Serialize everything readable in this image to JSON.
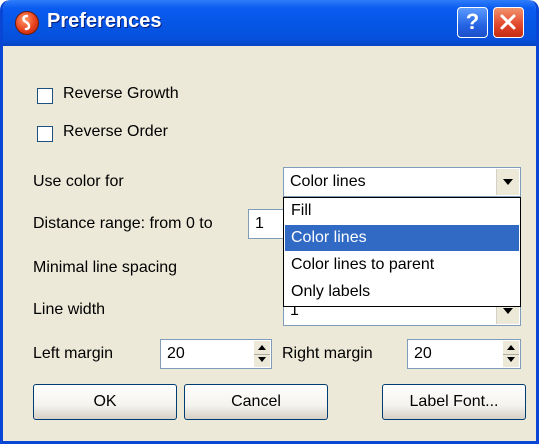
{
  "window": {
    "title": "Preferences",
    "help_label": "?"
  },
  "options": {
    "reverse_growth_label": "Reverse Growth",
    "reverse_order_label": "Reverse Order",
    "reverse_growth_checked": false,
    "reverse_order_checked": false
  },
  "use_color": {
    "label": "Use color for",
    "selected": "Color lines",
    "options": [
      "Fill",
      "Color lines",
      "Color lines to parent",
      "Only labels"
    ],
    "highlighted_index": 1
  },
  "distance_range": {
    "label": "Distance range: from 0 to",
    "value": "1"
  },
  "minimal_line_spacing": {
    "label": "Minimal line spacing"
  },
  "line_width": {
    "label": "Line width",
    "value": "1"
  },
  "margins": {
    "left_label": "Left margin",
    "left_value": "20",
    "right_label": "Right margin",
    "right_value": "20"
  },
  "buttons": {
    "ok": "OK",
    "cancel": "Cancel",
    "label_font": "Label Font..."
  },
  "colors": {
    "title_bar": "#0656e6",
    "dialog_bg": "#ece9d8",
    "selection": "#316ac5",
    "close_button": "#e1452a"
  }
}
